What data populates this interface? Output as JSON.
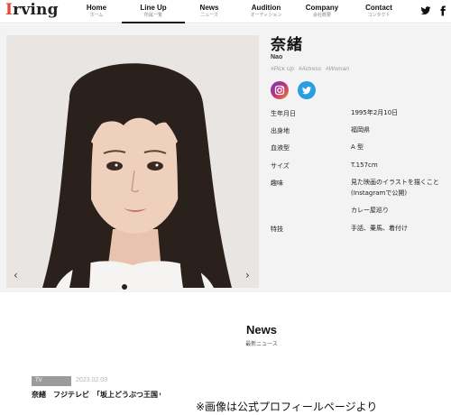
{
  "header": {
    "logo": "Irving",
    "nav": [
      {
        "en": "Home",
        "ja": "ホーム"
      },
      {
        "en": "Line Up",
        "ja": "所属一覧"
      },
      {
        "en": "News",
        "ja": "ニュース"
      },
      {
        "en": "Audition",
        "ja": "オーディション"
      },
      {
        "en": "Company",
        "ja": "会社概要"
      },
      {
        "en": "Contact",
        "ja": "コンタクト"
      }
    ],
    "icons": [
      "twitter-icon",
      "facebook-icon"
    ]
  },
  "profile": {
    "name_ja": "奈緒",
    "name_en": "Nao",
    "tags": [
      "#Pick Up",
      "#Actress",
      "#Woman"
    ],
    "social": [
      "instagram-icon",
      "twitter-icon"
    ],
    "rows": [
      {
        "label": "生年月日",
        "value": "1995年2月10日"
      },
      {
        "label": "出身地",
        "value": "福岡県"
      },
      {
        "label": "血液型",
        "value": "A 型"
      },
      {
        "label": "サイズ",
        "value": "T.157cm"
      },
      {
        "label": "趣味",
        "value": "見た映画のイラストを描くこと (Instagramで公開)",
        "value2": "カレー屋巡り"
      },
      {
        "label": "特技",
        "value": "手話、乗馬、着付け"
      }
    ]
  },
  "carousel": {
    "prev": "‹",
    "next": "›",
    "active_slide": 1,
    "slide_count": 1
  },
  "news": {
    "title": "News",
    "subtitle": "最新ニュース",
    "items": [
      {
        "category": "TV",
        "date": "2023.02.03",
        "headline": "奈緒　フジテレビ　「坂上どうぶつ王国」"
      }
    ]
  },
  "caption": "※画像は公式プロフィールページより",
  "colors": {
    "accent": "#e2482f",
    "twitter": "#2a9fe0",
    "band": "#f3f3f3"
  }
}
